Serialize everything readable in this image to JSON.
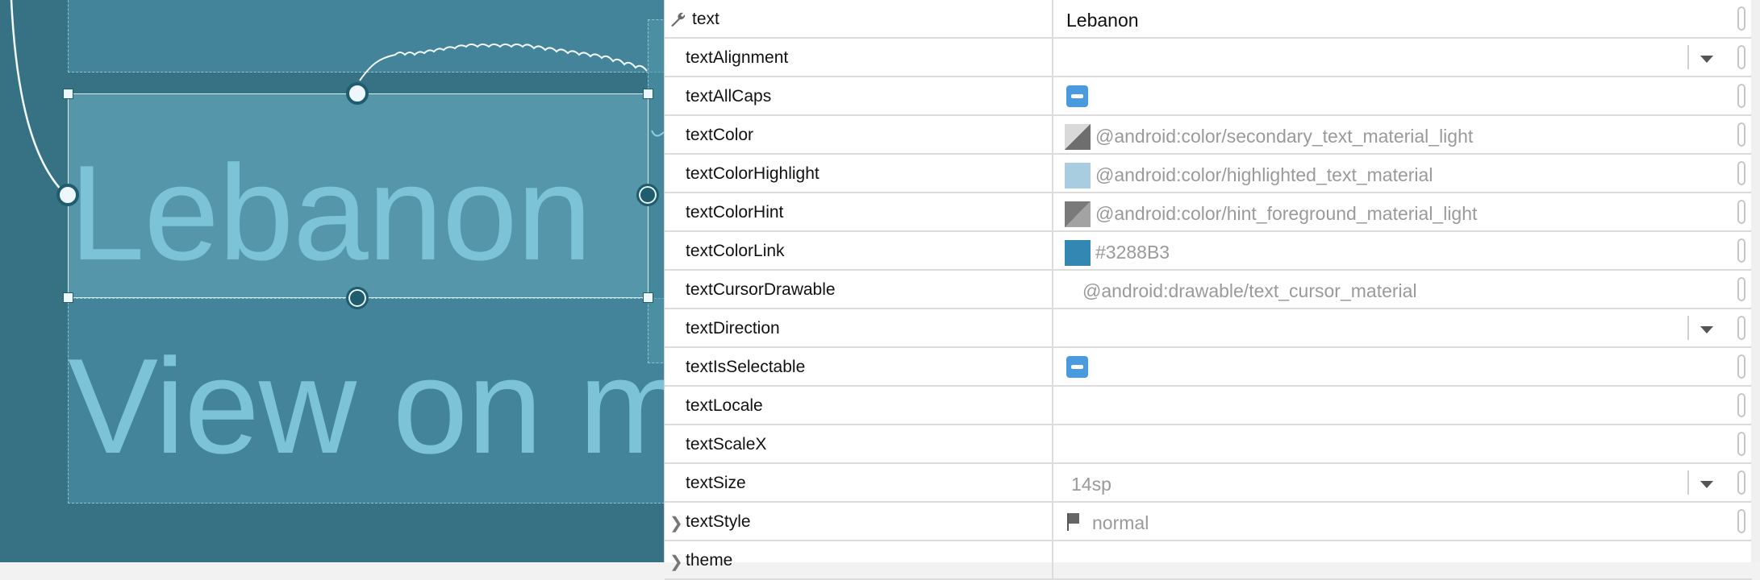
{
  "canvas": {
    "selected_view_text": "Lebanon",
    "below_view_text": "View on m"
  },
  "attributes": [
    {
      "name": "text",
      "value": "Lebanon",
      "kind": "text-primary",
      "icon": "wrench-icon"
    },
    {
      "name": "textAlignment",
      "value": "",
      "kind": "dropdown"
    },
    {
      "name": "textAllCaps",
      "value": "indeterminate",
      "kind": "checkbox"
    },
    {
      "name": "textColor",
      "value": "@android:color/secondary_text_material_light",
      "kind": "color",
      "swatch": "diagonal-light"
    },
    {
      "name": "textColorHighlight",
      "value": "@android:color/highlighted_text_material",
      "kind": "color",
      "swatch_color": "#A9CDE0"
    },
    {
      "name": "textColorHint",
      "value": "@android:color/hint_foreground_material_light",
      "kind": "color",
      "swatch": "diagonal-dark"
    },
    {
      "name": "textColorLink",
      "value": "#3288B3",
      "kind": "color",
      "swatch_color": "#3288B3"
    },
    {
      "name": "textCursorDrawable",
      "value": "@android:drawable/text_cursor_material",
      "kind": "text"
    },
    {
      "name": "textDirection",
      "value": "",
      "kind": "dropdown"
    },
    {
      "name": "textIsSelectable",
      "value": "indeterminate",
      "kind": "checkbox"
    },
    {
      "name": "textLocale",
      "value": "",
      "kind": "text"
    },
    {
      "name": "textScaleX",
      "value": "",
      "kind": "text"
    },
    {
      "name": "textSize",
      "value": "14sp",
      "kind": "dropdown"
    },
    {
      "name": "textStyle",
      "value": "normal",
      "kind": "flag",
      "expandable": true
    },
    {
      "name": "theme",
      "value": "",
      "kind": "text",
      "expandable": true
    }
  ]
}
